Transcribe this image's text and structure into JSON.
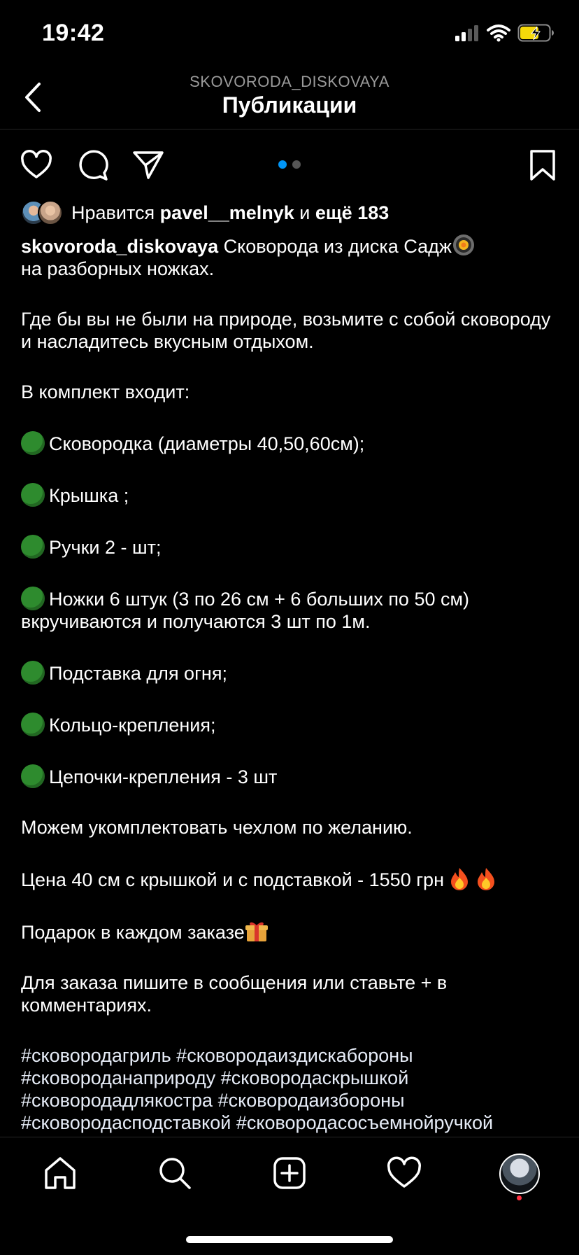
{
  "status": {
    "time": "19:42"
  },
  "header": {
    "subtitle": "SKOVORODA_DISKOVAYA",
    "title": "Публикации"
  },
  "likes": {
    "prefix": "Нравится ",
    "user": "pavel__melnyk",
    "middle": " и ",
    "more": "ещё 183"
  },
  "caption": {
    "username": "skovoroda_diskovaya",
    "intro": " Сковорода из диска Садж",
    "intro2": "на разборных ножках.",
    "p2": "Где бы вы не были на природе, возьмите с собой сковороду и насладитесь вкусным отдыхом.",
    "p3": "В комплект входит:",
    "items": [
      "Сковородка (диаметры 40,50,60см);",
      "Крышка ;",
      "Ручки 2 - шт;",
      "Ножки 6 штук (3 по 26 см + 6 больших по 50 см) вкручиваются и получаются 3 шт по 1м.",
      "Подставка для огня;",
      "Кольцо-крепления;",
      "Цепочки-крепления - 3 шт"
    ],
    "p4": "Можем укомплектовать чехлом по желанию.",
    "p5": "Цена 40 см с крышкой и с подставкой - 1550 грн ",
    "p6": "Подарок в каждом заказе",
    "p7": "Для заказа пишите в сообщения или ставьте + в комментариях.",
    "hashtags": "#сковородагриль #сковородаиздискабороны #сковороданаприроду #сковородаскрышкой #сковородадлякостра #сковородаизбороны #сковородасподставкой #сковородасосъемнойручкой #сковородасадж"
  },
  "carousel": {
    "active_color": "#0095f6",
    "inactive_color": "#555555"
  },
  "colors": {
    "bullet": "#2e8b2e",
    "battery": "#f5d90a",
    "notification": "#ff3040"
  },
  "icons": [
    "back-icon",
    "heart-icon",
    "comment-icon",
    "share-icon",
    "bookmark-icon",
    "home-icon",
    "search-icon",
    "add-icon",
    "activity-icon",
    "profile-avatar"
  ]
}
